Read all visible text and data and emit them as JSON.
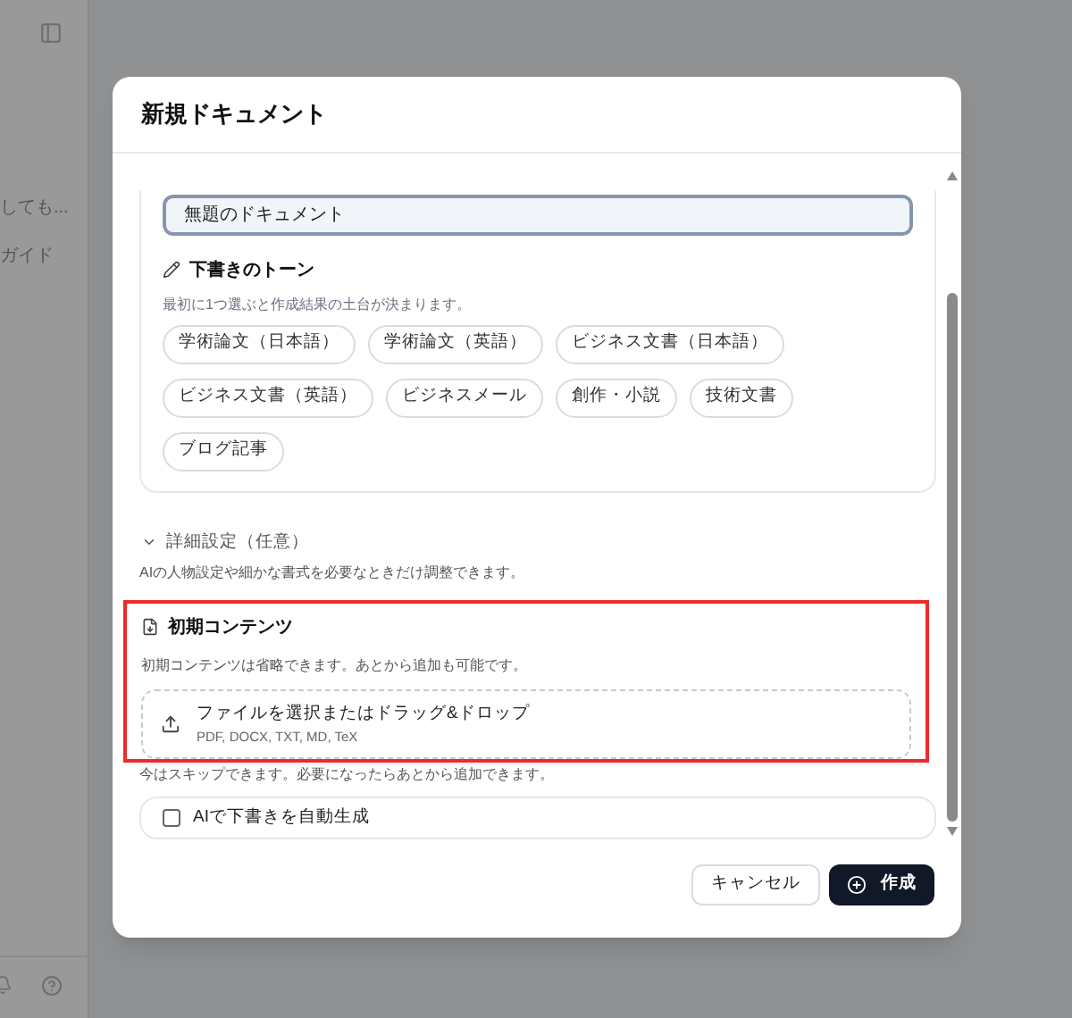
{
  "sidebar": {
    "items": [
      {
        "label": "しても..."
      },
      {
        "label": "ガイド"
      }
    ]
  },
  "dialog": {
    "title": "新規ドキュメント",
    "title_field": {
      "value": "無題のドキュメント"
    },
    "tone": {
      "heading": "下書きのトーン",
      "description": "最初に1つ選ぶと作成結果の土台が決まります。",
      "options": [
        {
          "label": "学術論文（日本語）",
          "selected": false
        },
        {
          "label": "学術論文（英語）",
          "selected": false
        },
        {
          "label": "ビジネス文書（日本語）",
          "selected": false
        },
        {
          "label": "ビジネス文書（英語）",
          "selected": false
        },
        {
          "label": "ビジネスメール",
          "selected": false
        },
        {
          "label": "創作・小説",
          "selected": false
        },
        {
          "label": "技術文書",
          "selected": false
        },
        {
          "label": "ブログ記事",
          "selected": false
        }
      ]
    },
    "advanced": {
      "label": "詳細設定（任意）",
      "expanded": false,
      "description": "AIの人物設定や細かな書式を必要なときだけ調整できます。"
    },
    "initial_content": {
      "heading": "初期コンテンツ",
      "description": "初期コンテンツは省略できます。あとから追加も可能です。",
      "dropzone": {
        "label": "ファイルを選択またはドラッグ&ドロップ",
        "formats": "PDF, DOCX, TXT, MD, TeX"
      },
      "note": "今はスキップできます。必要になったらあとから追加できます。"
    },
    "auto_generate": {
      "label": "AIで下書きを自動生成",
      "checked": false
    },
    "buttons": [
      {
        "label": "キャンセル",
        "kind": "secondary"
      },
      {
        "label": "作成",
        "kind": "primary"
      }
    ]
  }
}
